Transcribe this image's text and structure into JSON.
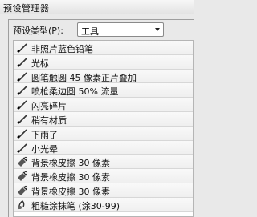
{
  "window": {
    "title": "预设管理器"
  },
  "preset_type": {
    "label": "预设类型(P):",
    "selected": "工具"
  },
  "presets": [
    {
      "label": "非照片蓝色铅笔",
      "icon": "brush-icon"
    },
    {
      "label": "光标",
      "icon": "brush-icon"
    },
    {
      "label": "圆笔触圆 45 像素正片叠加",
      "icon": "brush-icon"
    },
    {
      "label": "喷枪柔边圆 50% 流量",
      "icon": "brush-icon"
    },
    {
      "label": "闪亮碎片",
      "icon": "brush-icon"
    },
    {
      "label": "稍有材质",
      "icon": "brush-icon"
    },
    {
      "label": "下雨了",
      "icon": "brush-icon"
    },
    {
      "label": "小光晕",
      "icon": "brush-icon"
    },
    {
      "label": "背景橡皮擦 30 像素",
      "icon": "background-eraser-icon"
    },
    {
      "label": "背景橡皮擦 30 像素",
      "icon": "background-eraser-icon"
    },
    {
      "label": "背景橡皮擦 30 像素",
      "icon": "background-eraser-icon"
    },
    {
      "label": "粗糙涂抹笔 (涂30-99)",
      "icon": "smudge-icon"
    }
  ]
}
